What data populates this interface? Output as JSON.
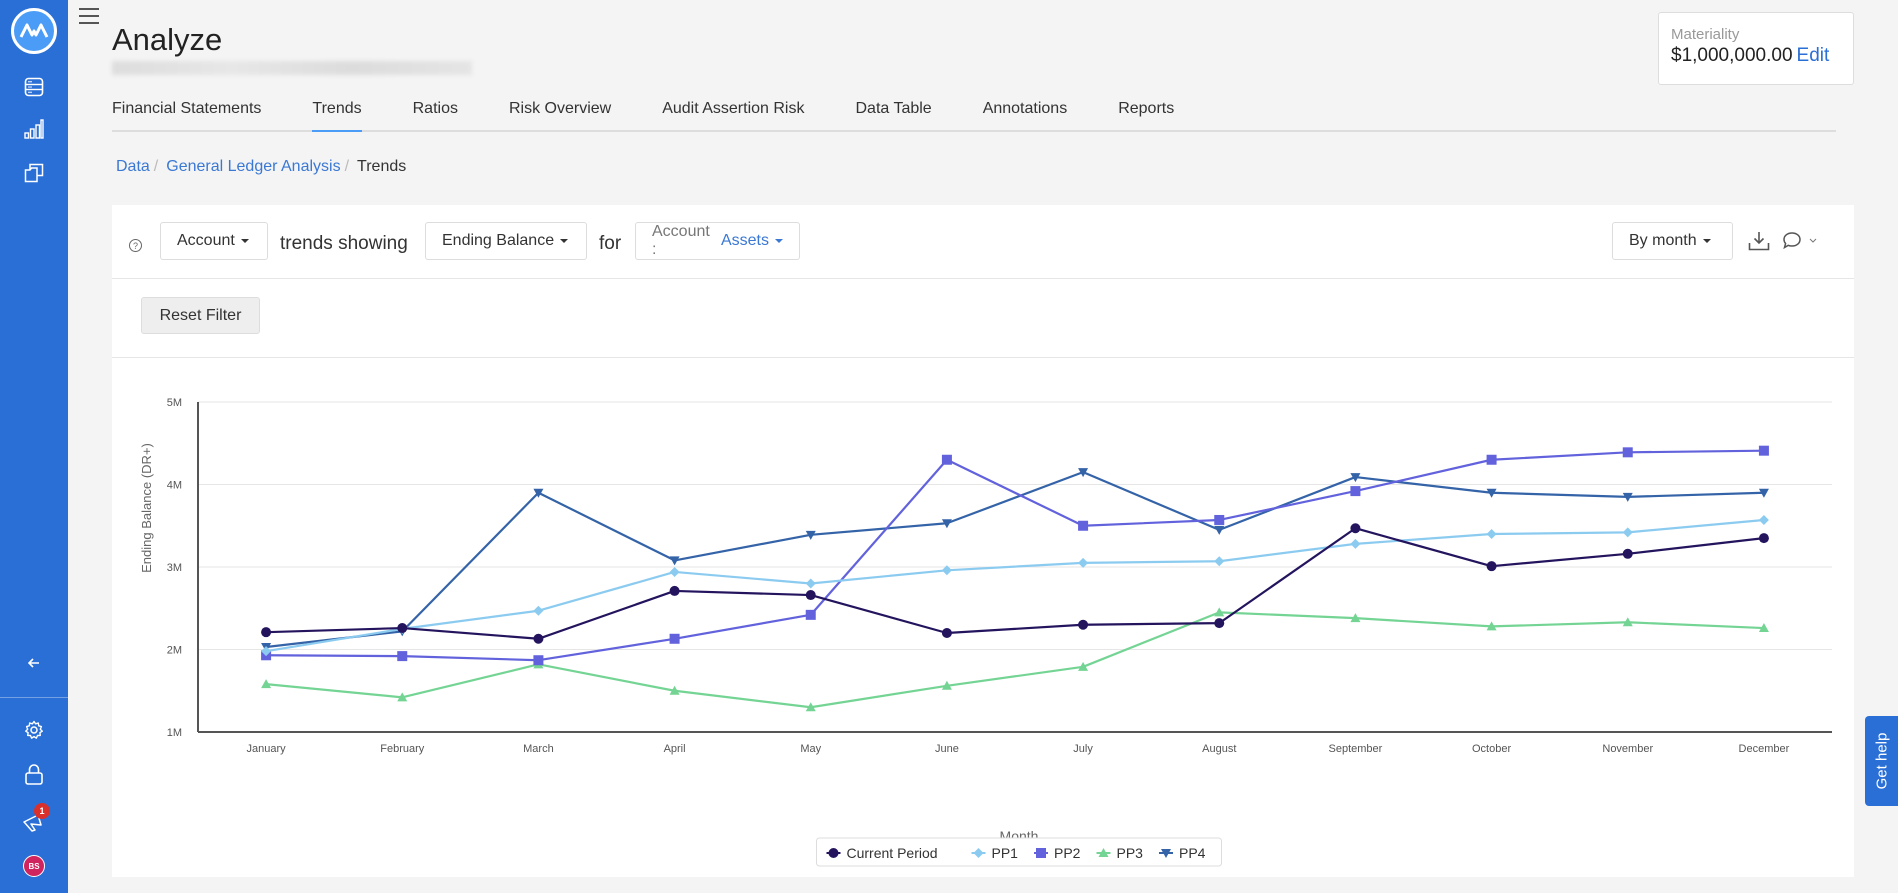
{
  "sidebar": {
    "logo": "app-logo",
    "items": [
      {
        "icon": "database-icon",
        "label": "Data"
      },
      {
        "icon": "bar-chart-icon",
        "label": "Analyze"
      },
      {
        "icon": "folders-icon",
        "label": "Engagements"
      }
    ],
    "collapse_icon": "arrow-left-icon",
    "bottom": [
      {
        "icon": "gear-icon"
      },
      {
        "icon": "lock-icon"
      },
      {
        "icon": "megaphone-icon",
        "badge": "1"
      }
    ],
    "avatar_initials": "BS"
  },
  "header": {
    "title": "Analyze"
  },
  "tabs": [
    {
      "label": "Financial Statements",
      "active": false
    },
    {
      "label": "Trends",
      "active": true
    },
    {
      "label": "Ratios",
      "active": false
    },
    {
      "label": "Risk Overview",
      "active": false
    },
    {
      "label": "Audit Assertion Risk",
      "active": false
    },
    {
      "label": "Data Table",
      "active": false
    },
    {
      "label": "Annotations",
      "active": false
    },
    {
      "label": "Reports",
      "active": false
    }
  ],
  "materiality": {
    "label": "Materiality",
    "value": "$1,000,000.00",
    "edit_label": "Edit"
  },
  "breadcrumb": {
    "items": [
      "Data",
      "General Ledger Analysis"
    ],
    "current": "Trends",
    "separator": "/"
  },
  "toolbar": {
    "help_icon": "question-circle-icon",
    "group_by": "Account",
    "text_trends_showing": "trends showing",
    "measure": "Ending Balance",
    "text_for": "for",
    "filter_prefix": "Account :",
    "filter_value": "Assets",
    "period": "By month",
    "download_icon": "download-icon",
    "comment_icon": "comment-icon"
  },
  "reset_filter_label": "Reset Filter",
  "get_help_label": "Get help",
  "colors": {
    "sidebar": "#2a6fd6",
    "link": "#3a78d4",
    "current_period": "#24145e",
    "pp1": "#8ccbf0",
    "pp2": "#6262dd",
    "pp3": "#74d494",
    "pp4": "#3463a8"
  },
  "chart_data": {
    "type": "line",
    "title": "",
    "xlabel": "Month",
    "ylabel": "Ending Balance (DR+)",
    "categories": [
      "January",
      "February",
      "March",
      "April",
      "May",
      "June",
      "July",
      "August",
      "September",
      "October",
      "November",
      "December"
    ],
    "ylim": [
      1000000,
      5000000
    ],
    "yticks": [
      {
        "value": 1000000,
        "label": "1M"
      },
      {
        "value": 2000000,
        "label": "2M"
      },
      {
        "value": 3000000,
        "label": "3M"
      },
      {
        "value": 4000000,
        "label": "4M"
      },
      {
        "value": 5000000,
        "label": "5M"
      }
    ],
    "grid": true,
    "legend_position": "bottom-center",
    "series": [
      {
        "name": "Current Period",
        "color": "#24145e",
        "marker": "circle",
        "values": [
          2210000,
          2260000,
          2130000,
          2710000,
          2660000,
          2200000,
          2300000,
          2320000,
          3470000,
          3010000,
          3160000,
          3350000
        ]
      },
      {
        "name": "PP1",
        "color": "#8ccbf0",
        "marker": "diamond",
        "values": [
          1980000,
          2250000,
          2470000,
          2940000,
          2800000,
          2960000,
          3050000,
          3070000,
          3280000,
          3400000,
          3420000,
          3570000
        ]
      },
      {
        "name": "PP2",
        "color": "#6262dd",
        "marker": "square",
        "values": [
          1930000,
          1920000,
          1870000,
          2130000,
          2420000,
          4300000,
          3500000,
          3570000,
          3920000,
          4300000,
          4390000,
          4410000
        ]
      },
      {
        "name": "PP3",
        "color": "#74d494",
        "marker": "triangle-up",
        "values": [
          1580000,
          1420000,
          1820000,
          1500000,
          1300000,
          1560000,
          1790000,
          2450000,
          2380000,
          2280000,
          2330000,
          2260000
        ]
      },
      {
        "name": "PP4",
        "color": "#3463a8",
        "marker": "triangle-down",
        "values": [
          2030000,
          2220000,
          3900000,
          3080000,
          3390000,
          3530000,
          4150000,
          3450000,
          4090000,
          3900000,
          3850000,
          3900000
        ]
      }
    ]
  }
}
